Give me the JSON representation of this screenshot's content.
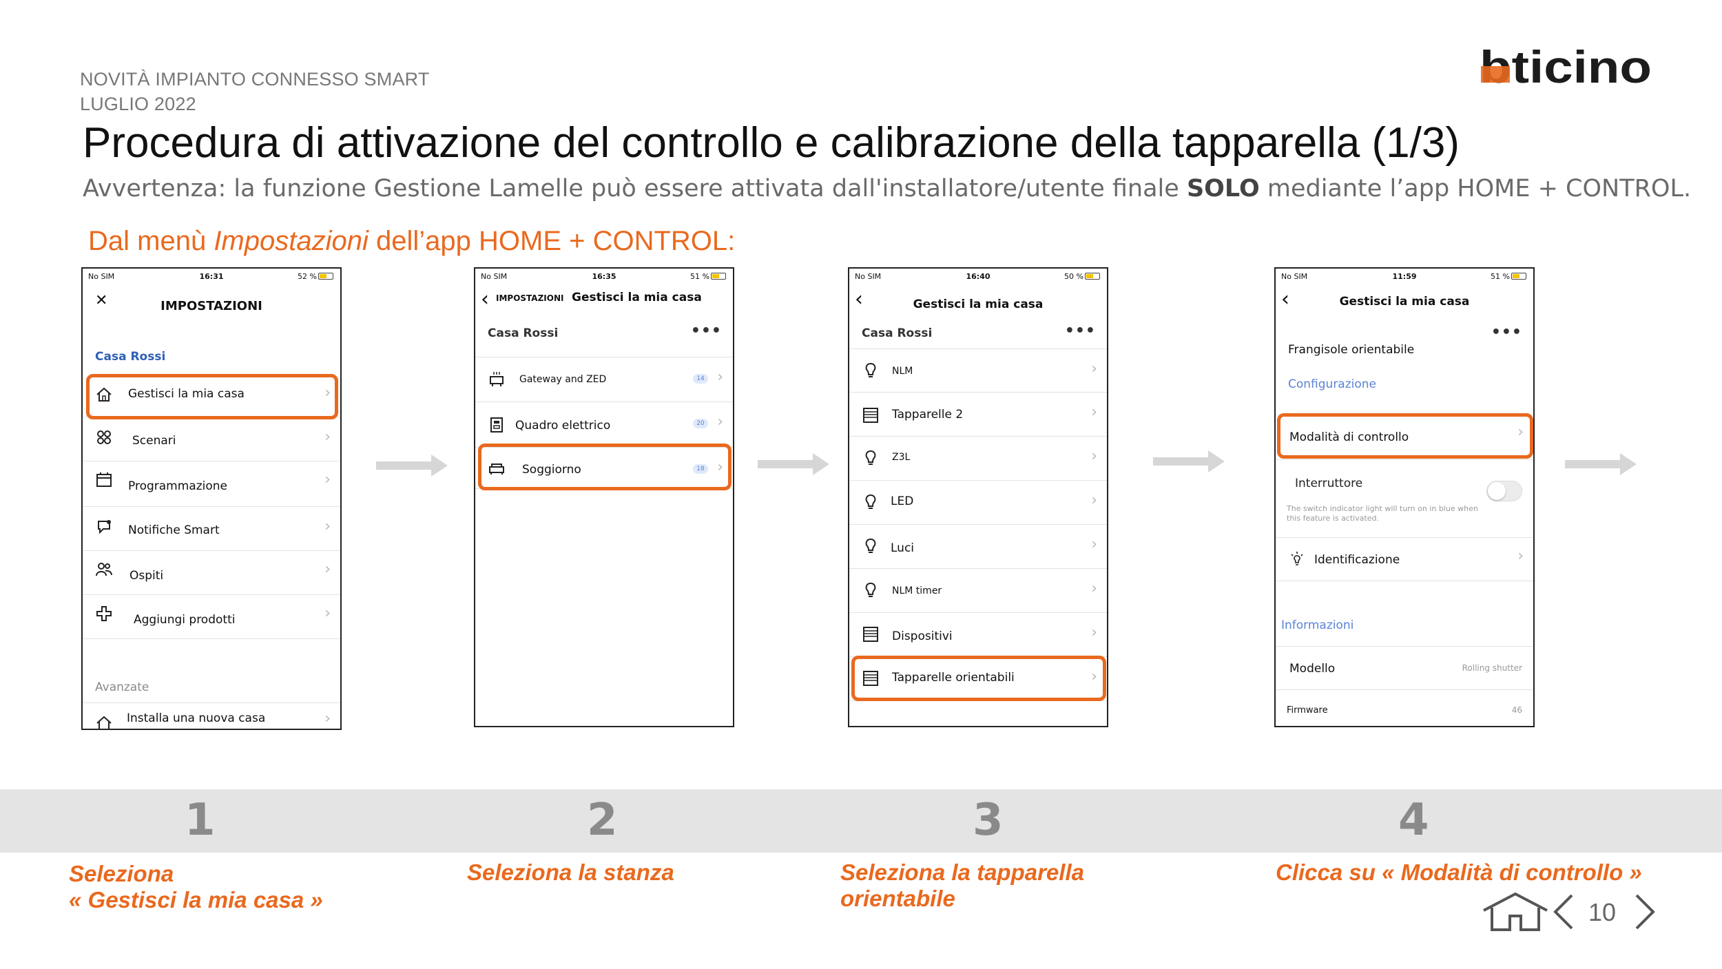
{
  "header": {
    "kicker_line1": "NOVITÀ  IMPIANTO CONNESSO SMART",
    "kicker_line2": "LUGLIO 2022",
    "title": "Procedura di attivazione del controllo e calibrazione della tapparella (1/3)",
    "warning_pre": "Avvertenza: la funzione Gestione Lamelle può essere attivata dall'installatore/utente finale ",
    "warning_bold": "SOLO",
    "warning_post": " mediante l’app HOME + CONTROL.",
    "intro_pre": "Dal menù ",
    "intro_italic": "Impostazioni",
    "intro_post": " dell’app HOME + CONTROL:",
    "brand": "bticino"
  },
  "colors": {
    "accent": "#e9691e",
    "band": "#e4e4e4",
    "link_blue": "#2f5fb5",
    "step_number": "#8a8a8a"
  },
  "screens": [
    {
      "status": {
        "carrier": "No SIM",
        "time": "16:31",
        "battery": "52 %"
      },
      "title": "IMPOSTAZIONI",
      "section": "Casa Rossi",
      "items": [
        {
          "icon": "home-icon",
          "label": "Gestisci la mia casa"
        },
        {
          "icon": "scenes-icon",
          "label": "Scenari"
        },
        {
          "icon": "calendar-icon",
          "label": "Programmazione"
        },
        {
          "icon": "notification-icon",
          "label": "Notifiche Smart"
        },
        {
          "icon": "guests-icon",
          "label": "Ospiti"
        },
        {
          "icon": "add-product-icon",
          "label": "Aggiungi prodotti"
        }
      ],
      "advanced_section": "Avanzate",
      "advanced_item": {
        "icon": "new-home-icon",
        "label": "Installa una nuova casa"
      }
    },
    {
      "status": {
        "carrier": "No SIM",
        "time": "16:35",
        "battery": "51 %"
      },
      "back_label": "IMPOSTAZIONI",
      "title": "Gestisci la mia casa",
      "section": "Casa Rossi",
      "items": [
        {
          "icon": "gateway-icon",
          "label": "Gateway and ZED",
          "badge": "14"
        },
        {
          "icon": "panel-icon",
          "label": "Quadro elettrico",
          "badge": "20"
        },
        {
          "icon": "sofa-icon",
          "label": "Soggiorno",
          "badge": "18"
        }
      ]
    },
    {
      "status": {
        "carrier": "No SIM",
        "time": "16:40",
        "battery": "50 %"
      },
      "title": "Gestisci la mia casa",
      "section": "Casa Rossi",
      "items": [
        {
          "icon": "bulb-icon",
          "label": "NLM"
        },
        {
          "icon": "shutter-icon",
          "label": "Tapparelle 2"
        },
        {
          "icon": "bulb-icon",
          "label": "Z3L"
        },
        {
          "icon": "bulb-icon",
          "label": "LED"
        },
        {
          "icon": "bulb-icon",
          "label": "Luci"
        },
        {
          "icon": "bulb-icon",
          "label": "NLM timer"
        },
        {
          "icon": "shutter-icon",
          "label": "Dispositivi"
        },
        {
          "icon": "shutter-icon",
          "label": "Tapparelle orientabili"
        }
      ]
    },
    {
      "status": {
        "carrier": "No SIM",
        "time": "11:59",
        "battery": "51 %"
      },
      "title": "Gestisci la mia casa",
      "device_name": "Frangisole orientabile",
      "config_label": "Configurazione",
      "mode_label": "Modalità di controllo",
      "switch_label": "Interruttore",
      "switch_help": "The switch indicator light will turn on in blue when this feature is activated.",
      "ident_label": "Identificazione",
      "info_section": "Informazioni",
      "model_label": "Modello",
      "model_value": "Rolling shutter",
      "firmware_label": "Firmware",
      "firmware_value": "46"
    }
  ],
  "steps": [
    {
      "number": "1",
      "line1": "Seleziona",
      "line2": "« Gestisci la mia casa »"
    },
    {
      "number": "2",
      "line1": "Seleziona la stanza"
    },
    {
      "number": "3",
      "line1": "Seleziona la tapparella",
      "line2": "orientabile"
    },
    {
      "number": "4",
      "line1": "Clicca su «  Modalità di controllo »"
    }
  ],
  "footer": {
    "page_number": "10"
  }
}
